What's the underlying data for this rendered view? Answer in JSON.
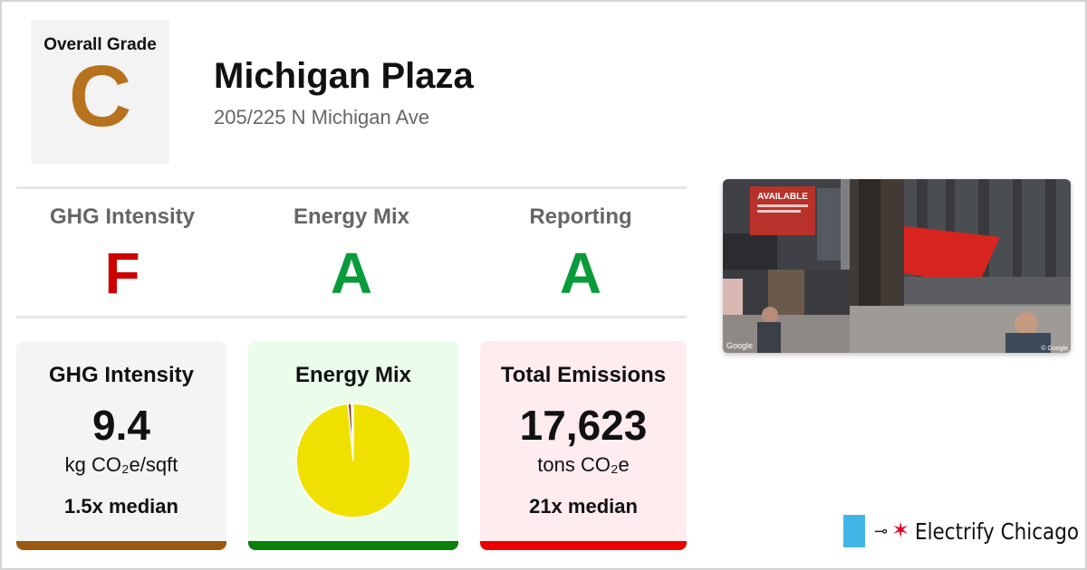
{
  "overall": {
    "label": "Overall Grade",
    "grade": "C",
    "grade_color": "#b6721c"
  },
  "building": {
    "name": "Michigan Plaza",
    "address": "205/225 N Michigan Ave"
  },
  "grades": [
    {
      "label": "GHG Intensity",
      "value": "F",
      "color": "#cc0000"
    },
    {
      "label": "Energy Mix",
      "value": "A",
      "color": "#0a9b3b"
    },
    {
      "label": "Reporting",
      "value": "A",
      "color": "#0a9b3b"
    }
  ],
  "cards": {
    "ghg": {
      "title": "GHG Intensity",
      "value": "9.4",
      "unit": "kg CO₂e/sqft",
      "median": "1.5x median",
      "bg": "#f4f4f4",
      "bar": "#9a5a12"
    },
    "mix": {
      "title": "Energy Mix",
      "bg": "#eafcea",
      "bar": "#0a7f0a"
    },
    "emissions": {
      "title": "Total Emissions",
      "value": "17,623",
      "unit": "tons CO₂e",
      "median": "21x median",
      "bg": "#ffecef",
      "bar": "#ee0000"
    }
  },
  "energy_mix_chart": {
    "type": "pie",
    "slices": [
      {
        "share": 0.985,
        "color": "#f0e000"
      },
      {
        "share": 0.01,
        "color": "#7a3c1c"
      },
      {
        "share": 0.005,
        "color": "#c9b9a8"
      }
    ]
  },
  "photo": {
    "watermark_left": "Google",
    "watermark_right": "© Google",
    "sign_text": "AVAILABLE"
  },
  "logo": {
    "brand": "Electrify Chicago",
    "flag_color": "#41b6e6",
    "star_color": "#e4002b"
  }
}
